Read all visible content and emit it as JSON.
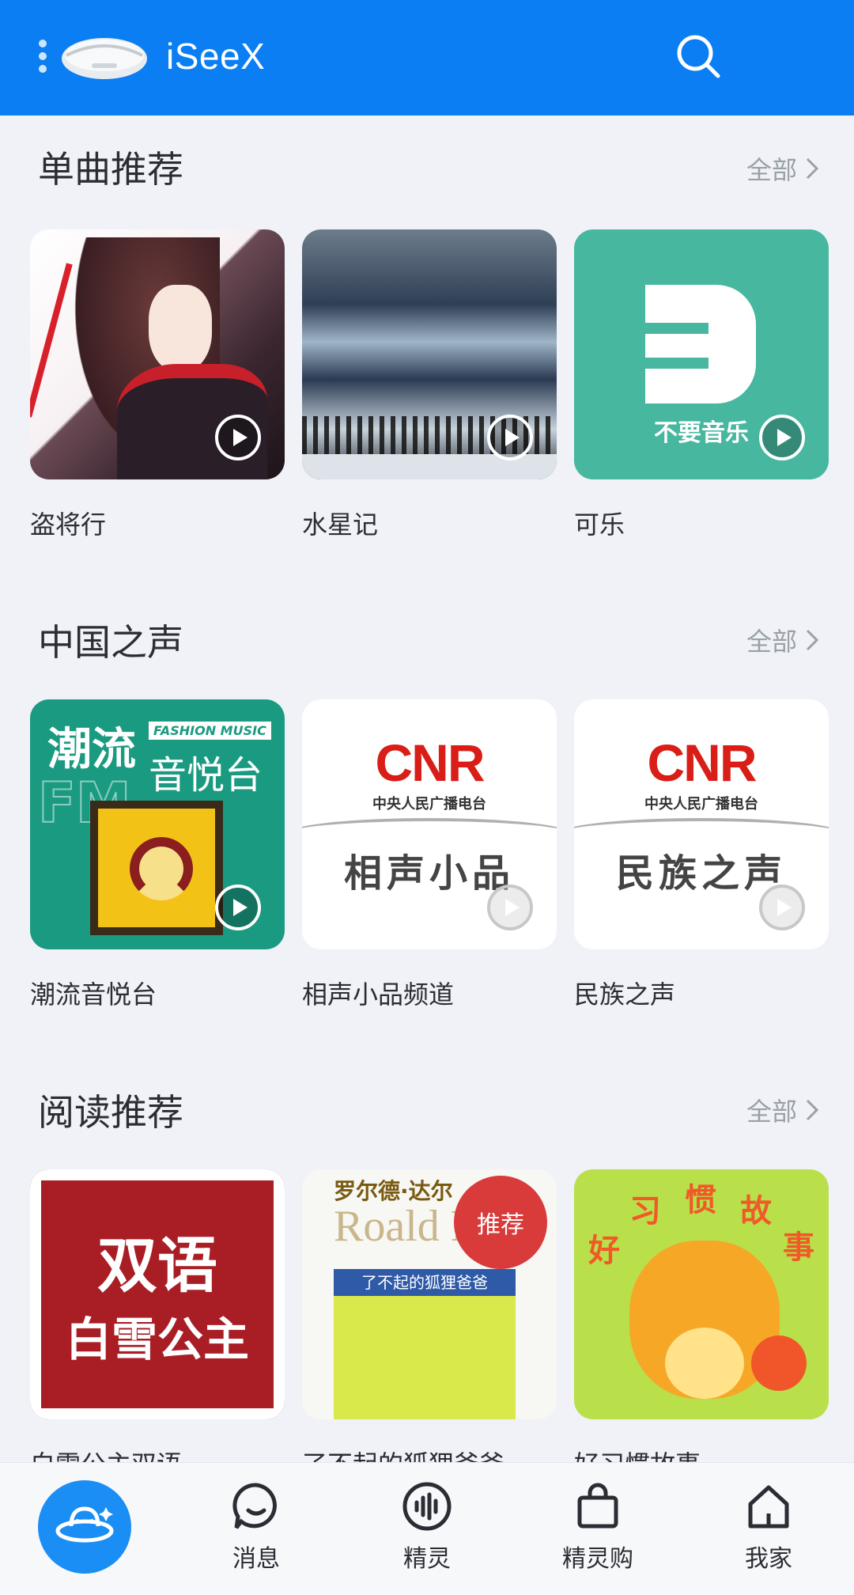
{
  "header": {
    "app_title": "iSeeX",
    "brand_color": "#0a7ef2"
  },
  "sections": [
    {
      "title": "单曲推荐",
      "all_label": "全部",
      "items": [
        {
          "label": "盗将行"
        },
        {
          "label": "水星记"
        },
        {
          "label": "可乐",
          "art_text": "不要音乐"
        }
      ]
    },
    {
      "title": "中国之声",
      "all_label": "全部",
      "items": [
        {
          "label": "潮流音悦台",
          "art_line1": "潮流",
          "art_badge": "FASHION MUSIC",
          "art_line2": "音悦台",
          "art_fm": "FM"
        },
        {
          "label": "相声小品频道",
          "art_logo": "CNR",
          "art_sub": "中央人民广播电台",
          "art_big": "相声小品"
        },
        {
          "label": "民族之声",
          "art_logo": "CNR",
          "art_sub": "中央人民广播电台",
          "art_big": "民族之声"
        }
      ]
    },
    {
      "title": "阅读推荐",
      "all_label": "全部",
      "items": [
        {
          "label": "白雪公主双语",
          "art_line1": "双语",
          "art_line2": "白雪公主"
        },
        {
          "label": "了不起的狐狸爸爸",
          "art_top": "罗尔德·达尔",
          "art_roald": "Roald Dahl",
          "art_band": "了不起的狐狸爸爸",
          "art_badge": "推荐"
        },
        {
          "label": "好习惯故事",
          "art_w1": "好",
          "art_w2": "习",
          "art_w3": "惯",
          "art_w4": "故",
          "art_w5": "事"
        }
      ]
    }
  ],
  "bottom_nav": {
    "items": [
      {
        "label": "消息",
        "icon": "chat-bubble-icon"
      },
      {
        "label": "精灵",
        "icon": "voice-wave-icon"
      },
      {
        "label": "精灵购",
        "icon": "shopping-bag-icon"
      },
      {
        "label": "我家",
        "icon": "home-icon"
      }
    ]
  }
}
